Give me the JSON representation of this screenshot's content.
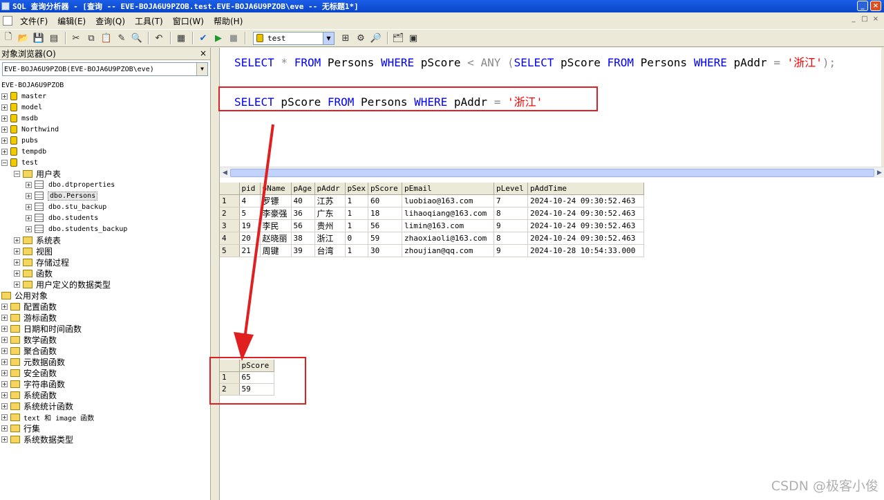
{
  "window": {
    "title": "SQL 查询分析器 - [查询 -- EVE-BOJA6U9PZOB.test.EVE-BOJA6U9PZOB\\eve -- 无标题1*]",
    "min_label": "_",
    "max_label": "□",
    "close_label": "×"
  },
  "menu": {
    "items": [
      "文件(F)",
      "编辑(E)",
      "查询(Q)",
      "工具(T)",
      "窗口(W)",
      "帮助(H)"
    ]
  },
  "toolbar": {
    "database_value": "test"
  },
  "object_browser": {
    "title": "对象浏览器(O)",
    "close_label": "×",
    "server_combo": "EVE-BOJA6U9PZOB(EVE-BOJA6U9PZOB\\eve)",
    "server_node": "EVE-BOJA6U9PZOB",
    "databases": [
      "master",
      "model",
      "msdb",
      "Northwind",
      "pubs",
      "tempdb",
      "test"
    ],
    "test_children": {
      "user_tables_label": "用户表",
      "tables": [
        "dbo.dtproperties",
        "dbo.Persons",
        "dbo.stu_backup",
        "dbo.students",
        "dbo.students_backup"
      ],
      "folders": [
        "系统表",
        "视图",
        "存储过程",
        "函数",
        "用户定义的数据类型"
      ]
    },
    "common_objects": {
      "label": "公用对象",
      "folders": [
        "配置函数",
        "游标函数",
        "日期和时间函数",
        "数学函数",
        "聚合函数",
        "元数据函数",
        "安全函数",
        "字符串函数",
        "系统函数",
        "系统统计函数",
        "text 和 image 函数",
        "行集",
        "系统数据类型"
      ]
    }
  },
  "editor": {
    "line1": {
      "tokens": [
        {
          "t": "SELECT",
          "c": "kw"
        },
        {
          "t": " * ",
          "c": "op"
        },
        {
          "t": "FROM",
          "c": "kw"
        },
        {
          "t": " Persons ",
          "c": ""
        },
        {
          "t": "WHERE",
          "c": "kw"
        },
        {
          "t": " pScore ",
          "c": ""
        },
        {
          "t": "< ANY (",
          "c": "op"
        },
        {
          "t": "SELECT",
          "c": "kw"
        },
        {
          "t": " pScore ",
          "c": ""
        },
        {
          "t": "FROM",
          "c": "kw"
        },
        {
          "t": " Persons ",
          "c": ""
        },
        {
          "t": "WHERE",
          "c": "kw"
        },
        {
          "t": " pAddr ",
          "c": ""
        },
        {
          "t": "= ",
          "c": "op"
        },
        {
          "t": "'浙江'",
          "c": "str"
        },
        {
          "t": ");",
          "c": "op"
        }
      ]
    },
    "line2": {
      "tokens": [
        {
          "t": "SELECT",
          "c": "kw"
        },
        {
          "t": " pScore ",
          "c": ""
        },
        {
          "t": "FROM",
          "c": "kw"
        },
        {
          "t": " Persons ",
          "c": ""
        },
        {
          "t": "WHERE",
          "c": "kw"
        },
        {
          "t": " pAddr ",
          "c": ""
        },
        {
          "t": "= ",
          "c": "op"
        },
        {
          "t": "'浙江'",
          "c": "str"
        }
      ]
    }
  },
  "result1": {
    "columns": [
      "pid",
      "pName",
      "pAge",
      "pAddr",
      "pSex",
      "pScore",
      "pEmail",
      "pLevel",
      "pAddTime"
    ],
    "rows": [
      [
        "1",
        "4",
        "罗镖",
        "40",
        "江苏",
        "1",
        "60",
        "luobiao@163.com",
        "7",
        "2024-10-24 09:30:52.463"
      ],
      [
        "2",
        "5",
        "李豪强",
        "36",
        "广东",
        "1",
        "18",
        "lihaoqiang@163.com",
        "8",
        "2024-10-24 09:30:52.463"
      ],
      [
        "3",
        "19",
        "李民",
        "56",
        "贵州",
        "1",
        "56",
        "limin@163.com",
        "9",
        "2024-10-24 09:30:52.463"
      ],
      [
        "4",
        "20",
        "赵晓丽",
        "38",
        "浙江",
        "0",
        "59",
        "zhaoxiaoli@163.com",
        "8",
        "2024-10-24 09:30:52.463"
      ],
      [
        "5",
        "21",
        "周键",
        "39",
        "台湾",
        "1",
        "30",
        "zhoujian@qq.com",
        "9",
        "2024-10-28 10:54:33.000"
      ]
    ]
  },
  "result2": {
    "columns": [
      "pScore"
    ],
    "rows": [
      [
        "1",
        "65"
      ],
      [
        "2",
        "59"
      ]
    ]
  },
  "watermark": "CSDN @极客小俊",
  "colors": {
    "keyword": "#0000ff",
    "string": "#ff0000",
    "annotation": "#e02020"
  }
}
